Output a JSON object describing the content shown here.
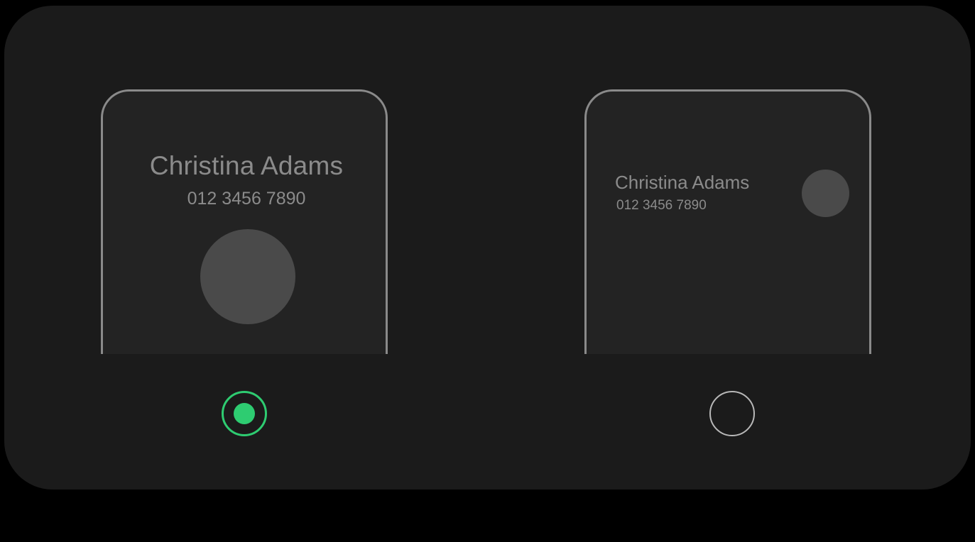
{
  "options": [
    {
      "contact_name": "Christina Adams",
      "contact_number": "012 3456 7890",
      "selected": true
    },
    {
      "contact_name": "Christina Adams",
      "contact_number": "012 3456 7890",
      "selected": false
    }
  ],
  "colors": {
    "accent": "#2ecc71",
    "panel_bg": "#1b1b1b",
    "frame_border": "#8a8a8a",
    "text": "#8b8b8b",
    "avatar": "#4a4a4a"
  }
}
